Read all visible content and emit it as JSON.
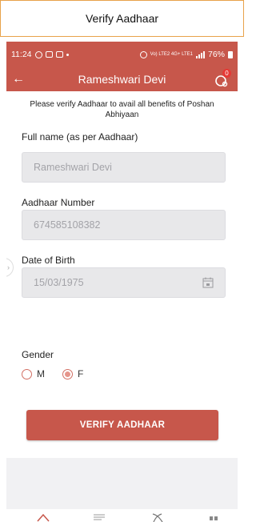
{
  "caption": {
    "title": "Verify Aadhaar"
  },
  "status_bar": {
    "time": "11:24",
    "network": "Vo) LTE2 4G+ LTE1",
    "battery": "76%"
  },
  "app_bar": {
    "title": "Rameshwari Devi",
    "notification_count": "0"
  },
  "form": {
    "intro": "Please verify Aadhaar to avail all benefits of Poshan Abhiyaan",
    "full_name": {
      "label": "Full name (as per Aadhaar)",
      "value": "Rameshwari Devi"
    },
    "aadhaar": {
      "label": "Aadhaar Number",
      "value": "674585108382"
    },
    "dob": {
      "label": "Date of Birth",
      "value": "15/03/1975"
    },
    "gender": {
      "label": "Gender",
      "options": [
        {
          "label": "M",
          "selected": false
        },
        {
          "label": "F",
          "selected": true
        }
      ]
    },
    "verify_button": "VERIFY AADHAAR"
  },
  "bottom_nav": {
    "items": [
      {
        "icon": "home-icon"
      },
      {
        "icon": "list-icon"
      },
      {
        "icon": "cross-icon"
      },
      {
        "icon": "grid-icon"
      }
    ]
  },
  "colors": {
    "primary": "#c7574b",
    "field_bg": "#e8e8ea",
    "page_bg": "#ffffff",
    "caption_border": "#e8a24a"
  }
}
